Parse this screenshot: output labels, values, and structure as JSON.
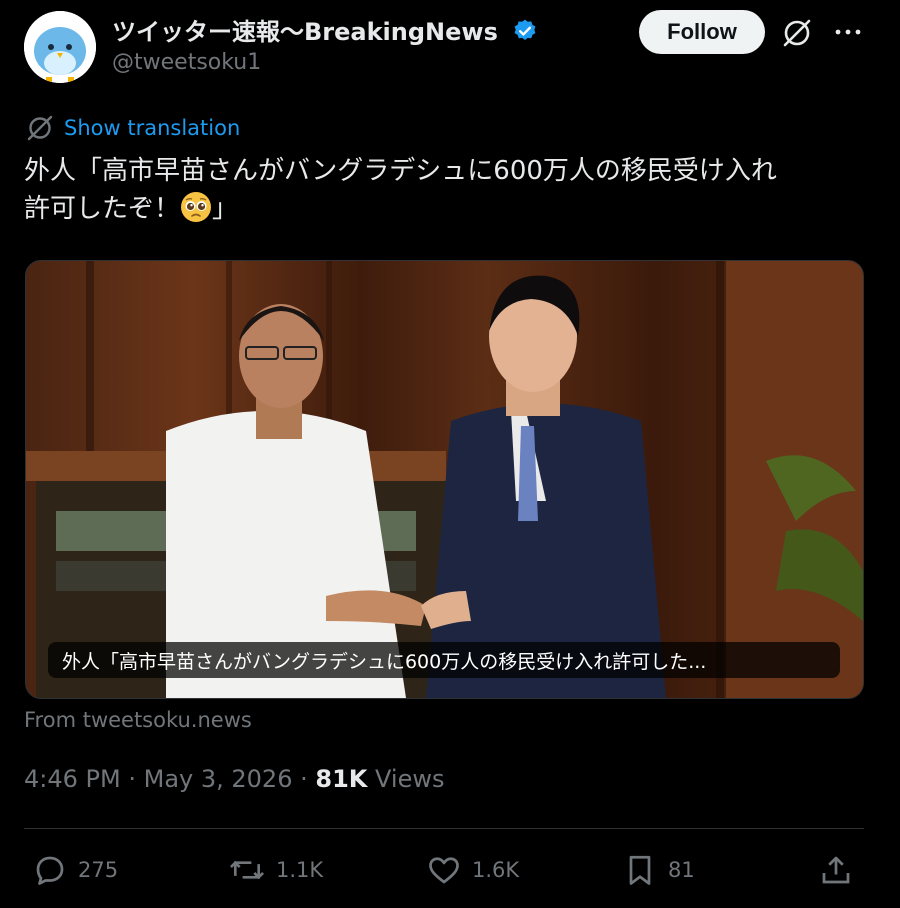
{
  "author": {
    "display_name": "ツイッター速報〜BreakingNews",
    "handle": "@tweetsoku1",
    "verified": true
  },
  "header": {
    "follow_label": "Follow"
  },
  "tweet": {
    "translate_label": "Show translation",
    "text_line1": "外人「高市早苗さんがバングラデシュに600万人の移民受け入れ",
    "text_line2_prefix": "許可したぞ！",
    "text_line2_suffix": "」",
    "emoji": "pleading-face",
    "media_caption": "外人「高市早苗さんがバングラデシュに600万人の移民受け入れ許可した...",
    "source": "From tweetsoku.news",
    "time": "4:46 PM",
    "date": "May 3, 2026",
    "views_count": "81K",
    "views_label": "Views"
  },
  "actions": {
    "replies": "275",
    "reposts": "1.1K",
    "likes": "1.6K",
    "bookmarks": "81"
  },
  "colors": {
    "link": "#1d9bf0",
    "muted": "#71767b",
    "text": "#e7e9ea",
    "background": "#000000"
  }
}
